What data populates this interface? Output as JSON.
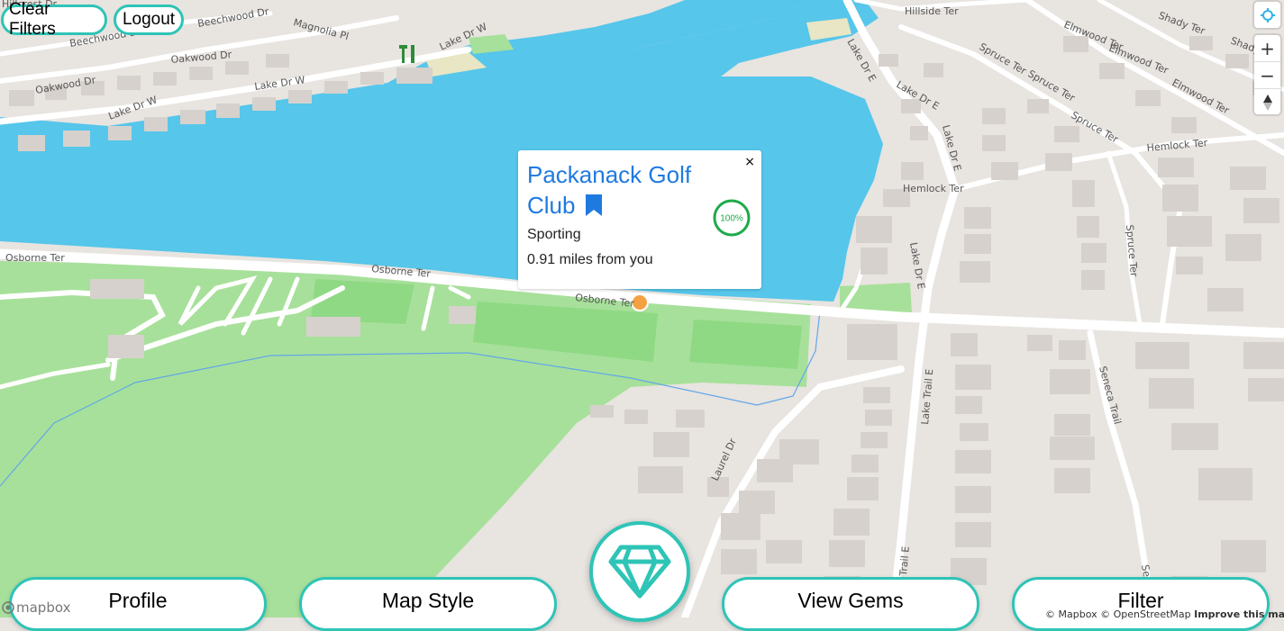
{
  "header": {
    "clear_filters_label": "Clear Filters",
    "logout_label": "Logout"
  },
  "map": {
    "road_labels": [
      "Hillcrest Dr",
      "Beechwood Dr",
      "Beechwood Dr",
      "Magnolia Pl",
      "Oakwood Dr",
      "Oakwood Dr",
      "Lake Dr W",
      "Lake Dr W",
      "Lake Dr W",
      "Hillside Ter",
      "Shady Ter",
      "Shady",
      "Elmwood Ter",
      "Elmwood Ter",
      "Elmwood Ter",
      "Spruce Ter",
      "Spruce Ter",
      "Spruce Ter",
      "Lake Dr E",
      "Lake Dr E",
      "Lake Dr E",
      "Hemlock Ter",
      "Hemlock Ter",
      "Lake Dr E",
      "Spruce Ter",
      "Osborne Ter",
      "Osborne Ter",
      "Osborne Ter",
      "Lake Trail E",
      "Seneca Trail",
      "Laurel Dr",
      "Trail E",
      "Se"
    ],
    "colors": {
      "water": "#56c6ea",
      "park": "#a7e09a",
      "land": "#e8e4e0",
      "road": "#ffffff",
      "building": "#d6d1cc",
      "accent": "#2ec4b6"
    }
  },
  "popup": {
    "title": "Packanack Golf Club",
    "category": "Sporting",
    "distance": "0.91 miles from you",
    "score": "100%",
    "close_symbol": "×",
    "bookmark_icon": "bookmark-icon"
  },
  "controls": {
    "zoom_in": "+",
    "zoom_out": "−",
    "geolocate_icon": "geolocate-icon",
    "compass_icon": "compass-icon"
  },
  "footer": {
    "profile_label": "Profile",
    "map_style_label": "Map Style",
    "view_gems_label": "View Gems",
    "filter_label": "Filter",
    "gem_icon": "diamond-icon"
  },
  "attribution": {
    "mapbox": "© Mapbox",
    "osm": "© OpenStreetMap",
    "improve": "Improve this map",
    "logo_text": "mapbox"
  }
}
